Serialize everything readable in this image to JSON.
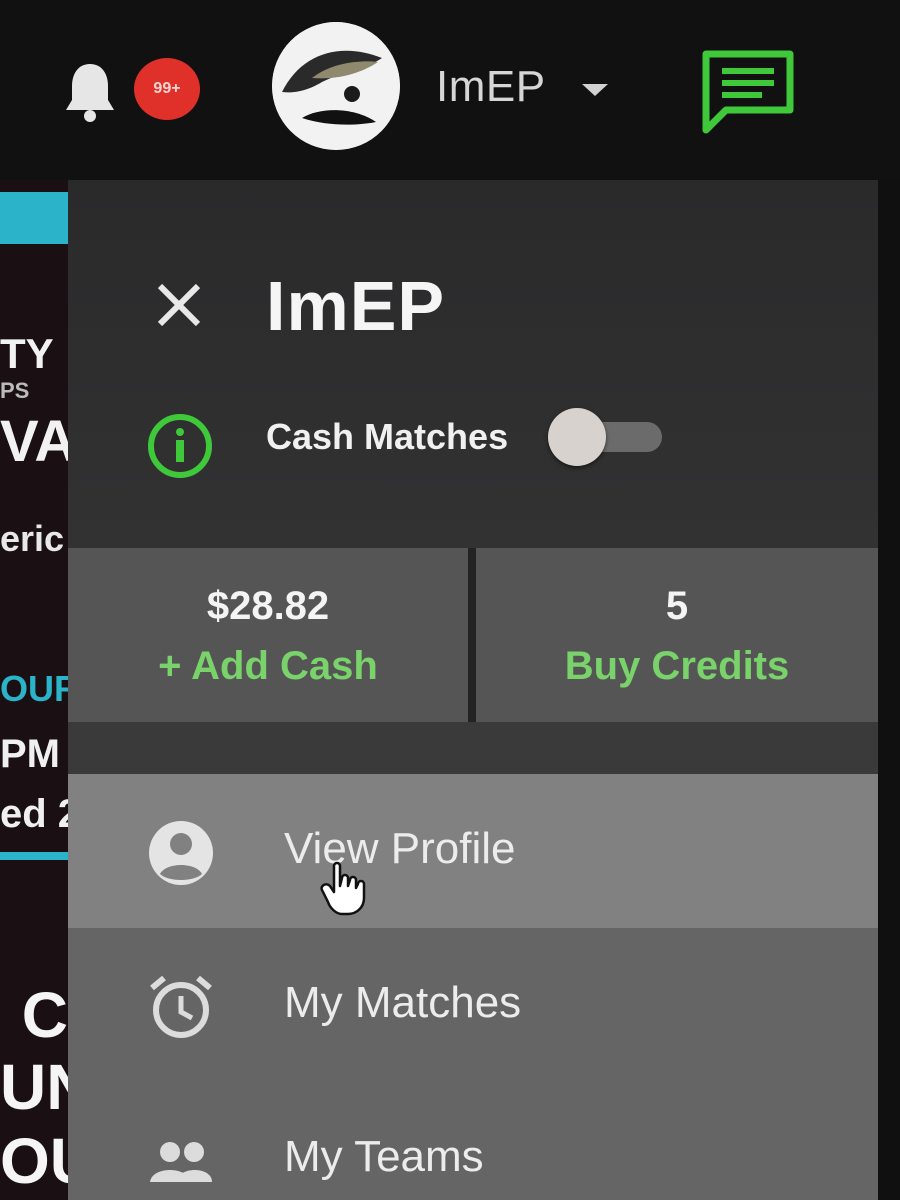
{
  "topbar": {
    "notification_count": "99+",
    "username": "ImEP",
    "icons": {
      "bell": "bell-icon",
      "caret": "chevron-down-icon",
      "chat": "chat-message-icon"
    }
  },
  "drawer": {
    "title": "ImEP",
    "close_icon": "close-icon",
    "cash_matches": {
      "label": "Cash Matches",
      "info_icon": "info-icon",
      "enabled": false
    },
    "wallet": {
      "cash_value": "$28.82",
      "cash_action": "+ Add Cash",
      "credits_value": "5",
      "credits_action": "Buy Credits"
    },
    "menu": [
      {
        "label": "View Profile",
        "icon": "person-icon",
        "active": true
      },
      {
        "label": "My Matches",
        "icon": "alarm-clock-icon",
        "active": false
      },
      {
        "label": "My Teams",
        "icon": "people-icon",
        "active": false
      }
    ]
  },
  "background_page": {
    "fragments": [
      "TY",
      "PS",
      "VAI",
      "eric",
      "OUR",
      "PM",
      "ed 2",
      "C",
      "UN",
      "OU"
    ]
  },
  "colors": {
    "accent_green": "#79d36a",
    "icon_green": "#3fc93a",
    "badge_red": "#e0302a",
    "cyan": "#2bb3c9"
  }
}
